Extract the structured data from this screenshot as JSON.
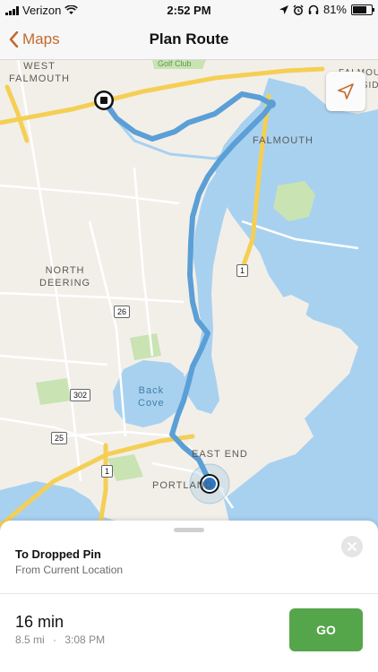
{
  "status": {
    "carrier": "Verizon",
    "time": "2:52 PM",
    "battery": "81%",
    "battery_level": 0.81
  },
  "nav": {
    "back_label": "Maps",
    "title": "Plan Route"
  },
  "map": {
    "labels": {
      "west_falmouth_1": "WEST",
      "west_falmouth_2": "FALMOUTH",
      "falmouth": "FALMOUTH",
      "falmouth_foreside_1": "FALMOU",
      "falmouth_foreside_2": "FORESIDE",
      "north_deering_1": "NORTH",
      "north_deering_2": "DEERING",
      "back_cove_1": "Back",
      "back_cove_2": "Cove",
      "east_end": "EAST END",
      "portland": "PORTLAND",
      "golf_club": "Golf Club"
    },
    "shields": {
      "us1_north": "1",
      "r26": "26",
      "i302": "302",
      "i25": "25",
      "us1_south": "1"
    },
    "colors": {
      "route": "#5b9fd6",
      "water": "#a8d1f0",
      "park": "#c9e3b3",
      "land": "#f2efe9",
      "highway": "#f5cf55"
    }
  },
  "sheet": {
    "destination_title": "To Dropped Pin",
    "destination_subtitle": "From Current Location",
    "duration": "16 min",
    "distance": "8.5 mi",
    "separator": "·",
    "arrival": "3:08 PM",
    "go_label": "GO"
  }
}
